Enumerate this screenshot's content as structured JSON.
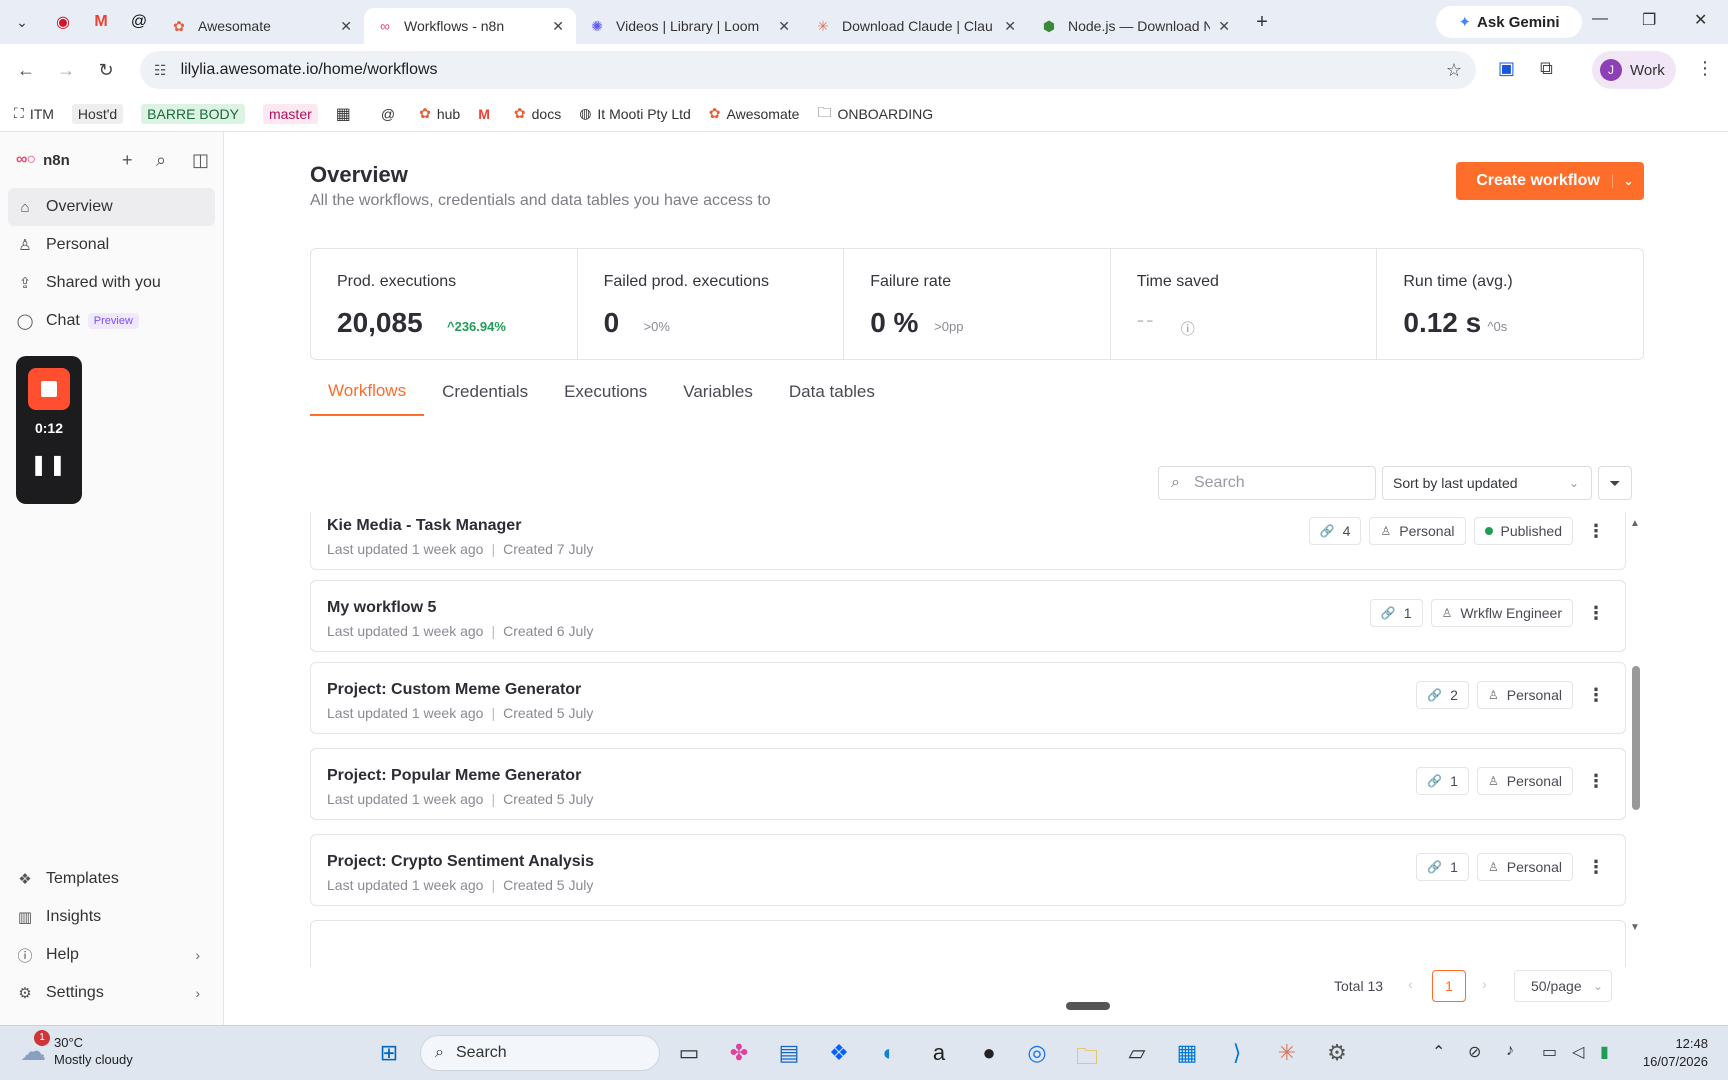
{
  "browser": {
    "tabs": [
      {
        "title": "Awesomate",
        "icon": "awesomate-icon"
      },
      {
        "title": "Workflows - n8n",
        "icon": "n8n-icon",
        "active": true
      },
      {
        "title": "Videos | Library | Loom",
        "icon": "loom-icon"
      },
      {
        "title": "Download Claude | Clau",
        "icon": "claude-icon"
      },
      {
        "title": "Node.js — Download N",
        "icon": "nodejs-icon"
      }
    ],
    "gemini_label": "Ask Gemini",
    "url": "lilylia.awesomate.io/home/workflows",
    "profile_initial": "J",
    "profile_label": "Work",
    "bookmarks": [
      "ITM",
      "Host'd",
      "BARRE BODY",
      "master",
      "hub",
      "docs",
      "It Mooti Pty Ltd",
      "Awesomate",
      "ONBOARDING"
    ]
  },
  "sidebar": {
    "brand": "n8n",
    "nav": [
      {
        "label": "Overview",
        "icon": "home-icon"
      },
      {
        "label": "Personal",
        "icon": "user-icon"
      },
      {
        "label": "Shared with you",
        "icon": "share-icon"
      },
      {
        "label": "Chat",
        "icon": "chat-icon",
        "badge": "Preview"
      }
    ],
    "bottom": [
      {
        "label": "Templates",
        "icon": "templates-icon"
      },
      {
        "label": "Insights",
        "icon": "insights-icon"
      },
      {
        "label": "Help",
        "icon": "help-icon"
      },
      {
        "label": "Settings",
        "icon": "settings-icon"
      }
    ],
    "loom_timer": "0:12"
  },
  "header": {
    "title": "Overview",
    "subtitle": "All the workflows, credentials and data tables you have access to",
    "create_label": "Create workflow"
  },
  "stats": [
    {
      "label": "Prod. executions",
      "value": "20,085",
      "delta": "^236.94%"
    },
    {
      "label": "Failed prod. executions",
      "value": "0",
      "delta": ">0%"
    },
    {
      "label": "Failure rate",
      "value": "0 %",
      "delta": ">0pp"
    },
    {
      "label": "Time saved",
      "value": "--",
      "delta": ""
    },
    {
      "label": "Run time (avg.)",
      "value": "0.12 s",
      "delta": "^0s"
    }
  ],
  "tabs": [
    "Workflows",
    "Credentials",
    "Executions",
    "Variables",
    "Data tables"
  ],
  "controls": {
    "search_placeholder": "Search",
    "sort_label": "Sort by last updated"
  },
  "workflows": [
    {
      "name": "Kie Media - Task Manager",
      "updated": "Last updated 1 week ago",
      "created": "Created 7 July",
      "links": "4",
      "owner": "Personal",
      "status": "Published"
    },
    {
      "name": "My workflow 5",
      "updated": "Last updated 1 week ago",
      "created": "Created 6 July",
      "links": "1",
      "owner": "Wrkflw Engineer",
      "status": ""
    },
    {
      "name": "Project: Custom Meme Generator",
      "updated": "Last updated 1 week ago",
      "created": "Created 5 July",
      "links": "2",
      "owner": "Personal",
      "status": ""
    },
    {
      "name": "Project: Popular Meme Generator",
      "updated": "Last updated 1 week ago",
      "created": "Created 5 July",
      "links": "1",
      "owner": "Personal",
      "status": ""
    },
    {
      "name": "Project: Crypto Sentiment Analysis",
      "updated": "Last updated 1 week ago",
      "created": "Created 5 July",
      "links": "1",
      "owner": "Personal",
      "status": ""
    }
  ],
  "pagination": {
    "total": "Total 13",
    "page": "1",
    "page_size": "50/page"
  },
  "taskbar": {
    "weather_temp": "30°C",
    "weather_desc": "Mostly cloudy",
    "weather_badge": "1",
    "search_label": "Search",
    "time": "12:48",
    "date": "16/07/2026"
  },
  "colors": {
    "accent": "#ff6d2a",
    "success": "#1f9d55",
    "brand": "#ea4b71"
  }
}
